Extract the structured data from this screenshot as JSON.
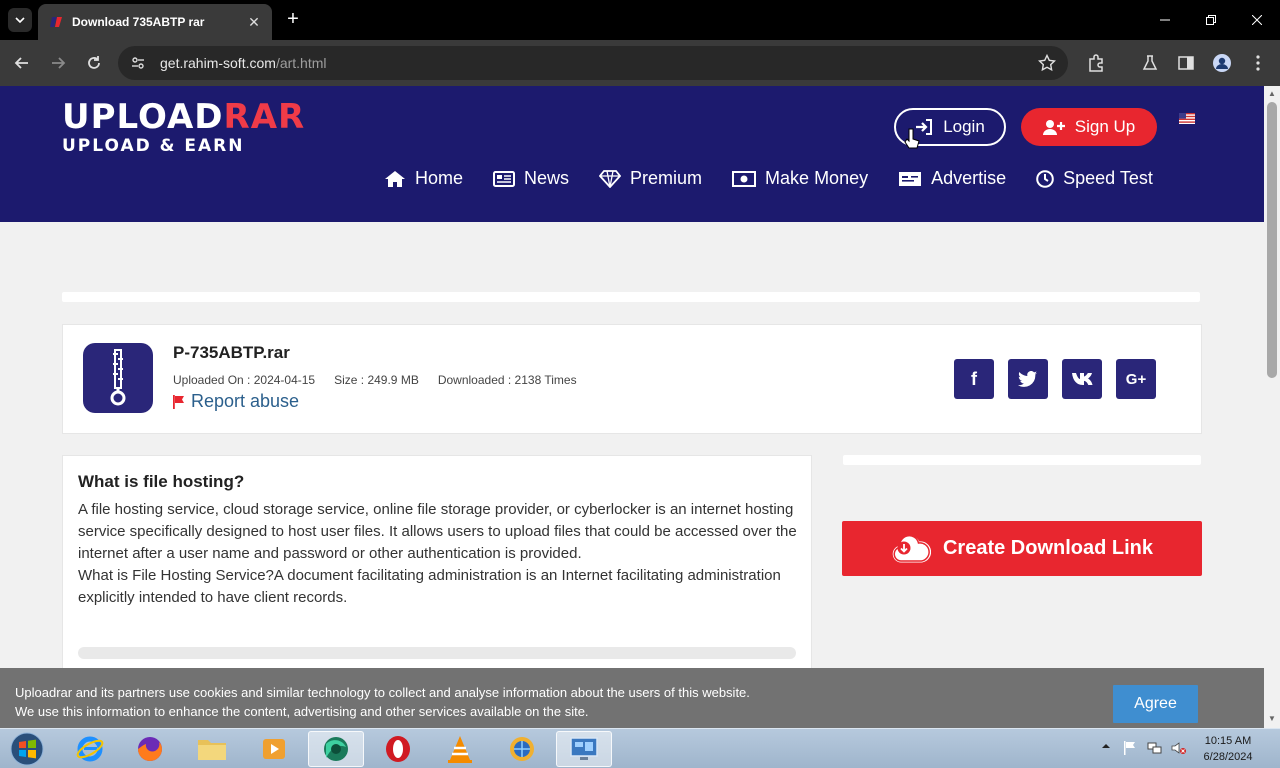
{
  "browser": {
    "tab_title": "Download 735ABTP rar",
    "url_host": "get.rahim-soft.com",
    "url_path": "/art.html"
  },
  "site": {
    "logo_top": "UPL",
    "logo_top_o": "O",
    "logo_top_ad": "AD",
    "logo_rar": "RAR",
    "logo_tagline": "UPLOAD & EARN",
    "login_label": "Login",
    "signup_label": "Sign Up",
    "nav": [
      {
        "label": "Home",
        "icon": "home-icon"
      },
      {
        "label": "News",
        "icon": "newspaper-icon"
      },
      {
        "label": "Premium",
        "icon": "diamond-icon"
      },
      {
        "label": "Make Money",
        "icon": "money-icon"
      },
      {
        "label": "Advertise",
        "icon": "id-card-icon"
      },
      {
        "label": "Speed Test",
        "icon": "clock-icon"
      }
    ],
    "brand_color": "#1c1a6e",
    "accent_color": "#e8262f"
  },
  "file": {
    "name": "P-735ABTP.rar",
    "uploaded": "Uploaded On : 2024-04-15",
    "size": "Size : 249.9 MB",
    "downloaded": "Downloaded : 2138 Times",
    "report_label": "Report abuse",
    "social": [
      "f",
      "twitter",
      "vk",
      "G+"
    ]
  },
  "article": {
    "heading": "What is file hosting?",
    "paragraph1": "A file hosting service, cloud storage service, online file storage provider, or cyberlocker is an internet hosting service specifically designed to host user files. It allows users to upload files that could be accessed over the internet after a user name and password or other authentication is provided.",
    "paragraph2": "What is File Hosting Service?A document facilitating administration is an Internet facilitating administration explicitly intended to have client records."
  },
  "download": {
    "button_label": "Create Download Link"
  },
  "cookie": {
    "line1": "Uploadrar and its partners use cookies and similar technology to collect and analyse information about the users of this website.",
    "line2": "We use this information to enhance the content, advertising and other services available on the site.",
    "agree_label": "Agree"
  },
  "taskbar": {
    "time": "10:15 AM",
    "date": "6/28/2024"
  }
}
